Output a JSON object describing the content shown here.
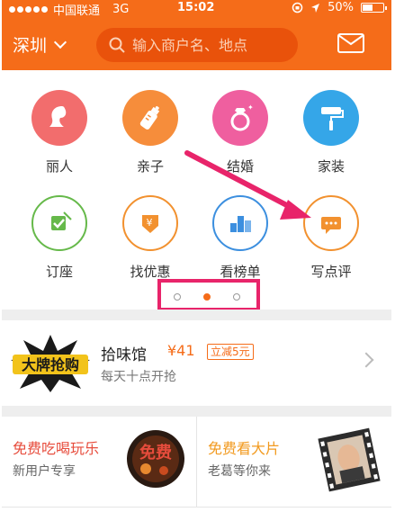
{
  "status": {
    "carrier": "中国联通",
    "network": "3G",
    "time": "15:02",
    "battery": "50%"
  },
  "nav": {
    "city": "深圳",
    "search_placeholder": "输入商户名、地点"
  },
  "categories": [
    {
      "label": "丽人",
      "icon": "beauty-icon",
      "color": "#f26d6d"
    },
    {
      "label": "亲子",
      "icon": "baby-bottle-icon",
      "color": "#f68d3b"
    },
    {
      "label": "结婚",
      "icon": "ring-icon",
      "color": "#ef5f9f"
    },
    {
      "label": "家装",
      "icon": "paint-roller-icon",
      "color": "#35a6e8"
    },
    {
      "label": "订座",
      "icon": "check-seat-icon",
      "color": "#66b94a"
    },
    {
      "label": "找优惠",
      "icon": "discount-icon",
      "color": "#f2912f"
    },
    {
      "label": "看榜单",
      "icon": "ranking-icon",
      "color": "#3c8fdf"
    },
    {
      "label": "写点评",
      "icon": "comment-icon",
      "color": "#f2912f"
    }
  ],
  "pager": {
    "count": 3,
    "active_index": 1
  },
  "promo": {
    "badge_text": "大牌抢购",
    "title": "拾味馆",
    "price": "¥41",
    "tag": "立减5元",
    "subtitle": "每天十点开抢"
  },
  "tiles": [
    {
      "title": "免费吃喝玩乐",
      "subtitle": "新用户专享",
      "image_text": "免费",
      "color": "#e74c3c"
    },
    {
      "title": "免费看大片",
      "subtitle": "老葛等你来",
      "color": "#f29a1f"
    }
  ],
  "colors": {
    "brand": "#f56c19",
    "highlight": "#e8246a"
  }
}
